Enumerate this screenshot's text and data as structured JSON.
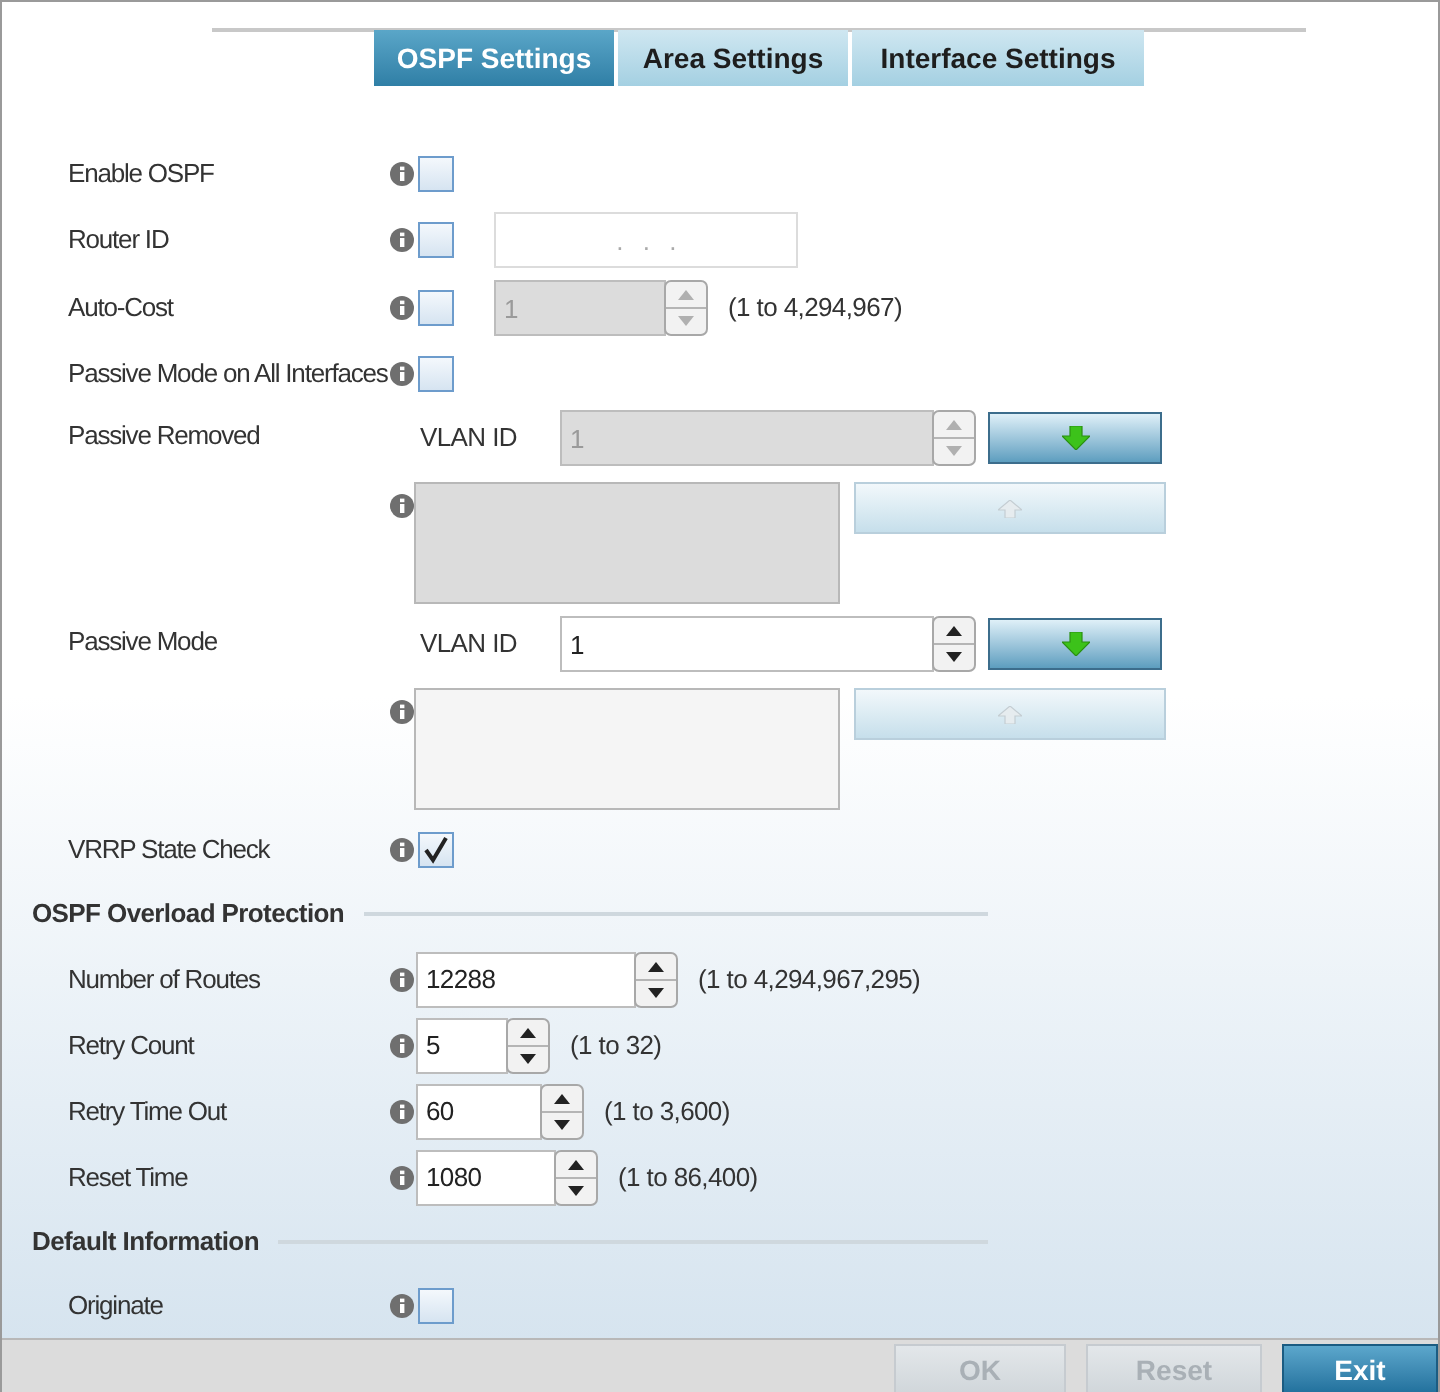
{
  "tabs": [
    {
      "label": "OSPF Settings",
      "selected": true
    },
    {
      "label": "Area Settings",
      "selected": false
    },
    {
      "label": "Interface Settings",
      "selected": false
    }
  ],
  "rows": [
    {
      "kind": "checkbox",
      "label": "Enable OSPF",
      "checked": false
    },
    {
      "kind": "checkbox_ip",
      "label": "Router ID",
      "checked": false,
      "placeholder": ".   .   ."
    },
    {
      "kind": "checkbox_spinner",
      "label": "Auto-Cost",
      "checked": false,
      "value": "1",
      "disabled": true,
      "range": "(1 to 4,294,967)"
    },
    {
      "kind": "checkbox",
      "label": "Passive Mode on All Interfaces",
      "checked": false
    },
    {
      "kind": "vlan_list",
      "label": "Passive Removed",
      "field_label": "VLAN ID",
      "value": "1",
      "disabled": true
    },
    {
      "kind": "vlan_list",
      "label": "Passive Mode",
      "field_label": "VLAN ID",
      "value": "1",
      "disabled": false
    },
    {
      "kind": "checkbox",
      "label": "VRRP State Check",
      "checked": true
    },
    {
      "kind": "section",
      "label": "OSPF Overload Protection"
    },
    {
      "kind": "spinner",
      "label": "Number of Routes",
      "value": "12288",
      "range": "(1 to 4,294,967,295)"
    },
    {
      "kind": "spinner",
      "label": "Retry Count",
      "value": "5",
      "range": "(1 to 32)"
    },
    {
      "kind": "spinner",
      "label": "Retry Time Out",
      "value": "60",
      "range": "(1 to 3,600)"
    },
    {
      "kind": "spinner",
      "label": "Reset Time",
      "value": "1080",
      "range": "(1 to 86,400)"
    },
    {
      "kind": "section",
      "label": "Default Information"
    },
    {
      "kind": "checkbox",
      "label": "Originate",
      "checked": false
    }
  ],
  "buttons": [
    {
      "label": "OK",
      "disabled": true
    },
    {
      "label": "Reset",
      "disabled": true
    },
    {
      "label": "Exit",
      "disabled": false
    }
  ]
}
